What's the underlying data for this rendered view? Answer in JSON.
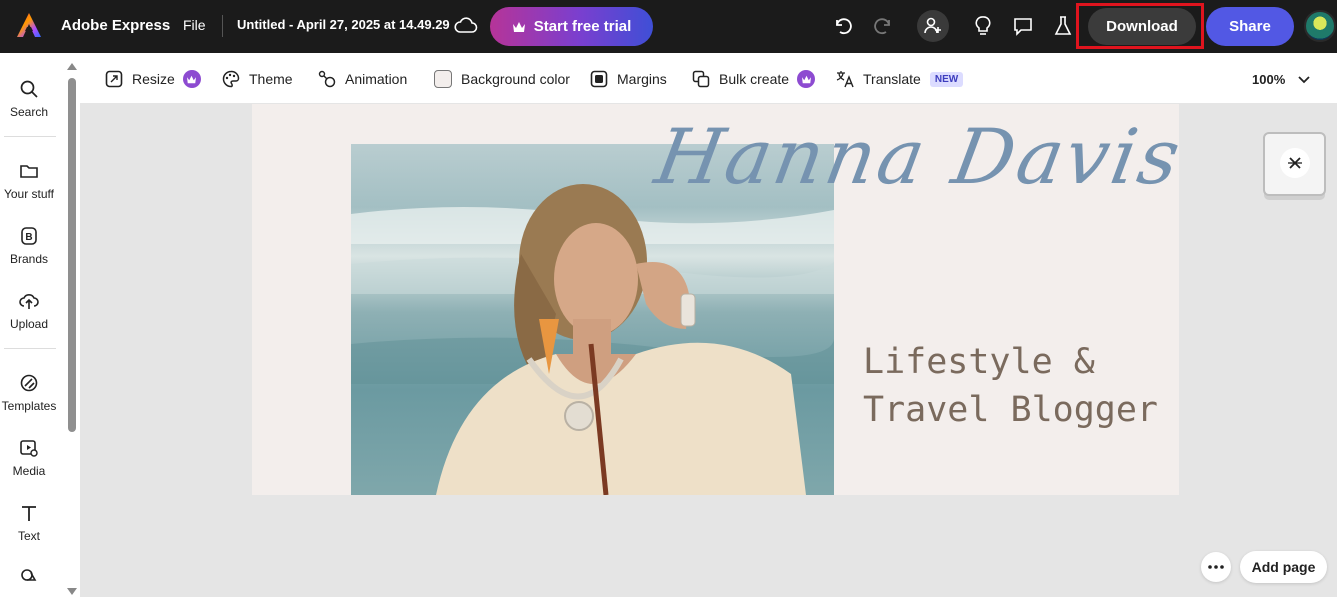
{
  "header": {
    "brand": "Adobe Express",
    "file_menu": "File",
    "document_title": "Untitled - April 27, 2025 at 14.49.29",
    "trial_button": "Start free trial",
    "download_button": "Download",
    "share_button": "Share",
    "icons": [
      "adobe-express-logo",
      "cloud-sync-icon",
      "crown-icon",
      "undo-icon",
      "redo-icon",
      "invite-collaborator-icon",
      "lightbulb-icon",
      "comment-icon",
      "flask-icon",
      "user-avatar"
    ]
  },
  "sidebar": {
    "items": [
      {
        "label": "Search",
        "icon": "search-icon"
      },
      {
        "label": "Your stuff",
        "icon": "folder-icon"
      },
      {
        "label": "Brands",
        "icon": "brands-icon"
      },
      {
        "label": "Upload",
        "icon": "upload-icon"
      },
      {
        "label": "Templates",
        "icon": "templates-icon"
      },
      {
        "label": "Media",
        "icon": "media-icon"
      },
      {
        "label": "Text",
        "icon": "text-icon"
      }
    ]
  },
  "toolbar": {
    "resize": "Resize",
    "theme": "Theme",
    "animation": "Animation",
    "background_color": "Background color",
    "margins": "Margins",
    "bulk_create": "Bulk create",
    "translate": "Translate",
    "translate_badge": "NEW",
    "zoom": "100%"
  },
  "canvas": {
    "name": "Hanna Davis",
    "subtitle_line1": "Lifestyle &",
    "subtitle_line2": "Travel Blogger",
    "page_background": "#f3eeec",
    "name_color": "#7693b0",
    "subtitle_color": "#7a6a5d"
  },
  "footer": {
    "add_page": "Add page"
  },
  "colors": {
    "topbar": "#1b1b1b",
    "share": "#5258e4",
    "highlight_frame": "#e0141e",
    "premium": "#8d4bd1"
  }
}
